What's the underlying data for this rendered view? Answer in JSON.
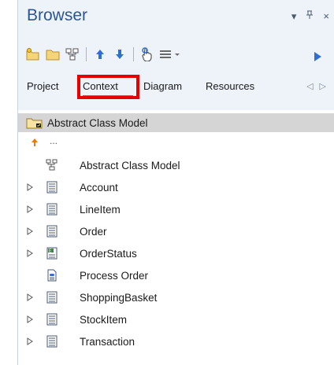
{
  "browser": {
    "title": "Browser",
    "controls": {
      "dropdown_glyph": "▾",
      "pin_glyph": "⊥",
      "close_glyph": "×"
    }
  },
  "toolbar": {
    "buttons": [
      {
        "icon": "new-package-icon"
      },
      {
        "icon": "folder-icon"
      },
      {
        "icon": "diagram-icon"
      },
      {
        "icon": "move-up-icon"
      },
      {
        "icon": "move-down-icon"
      },
      {
        "icon": "locate-icon"
      },
      {
        "icon": "menu-icon"
      },
      {
        "icon": "run-icon"
      }
    ]
  },
  "tabs": {
    "items": [
      "Project",
      "Context",
      "Diagram",
      "Resources"
    ],
    "active": "Context",
    "highlight_color": "#e60000",
    "nav_left": "◁",
    "nav_right": "▷"
  },
  "tree": {
    "root": {
      "label": "Abstract Class Model",
      "icon": "package-icon"
    },
    "up_label": "...",
    "items": [
      {
        "label": "Abstract Class Model",
        "icon": "diagram-icon",
        "expandable": false
      },
      {
        "label": "Account",
        "icon": "class-icon",
        "expandable": true
      },
      {
        "label": "LineItem",
        "icon": "class-icon",
        "expandable": true
      },
      {
        "label": "Order",
        "icon": "class-icon",
        "expandable": true
      },
      {
        "label": "OrderStatus",
        "icon": "enumeration-icon",
        "expandable": true
      },
      {
        "label": "Process Order",
        "icon": "activity-icon",
        "expandable": false
      },
      {
        "label": "ShoppingBasket",
        "icon": "class-icon",
        "expandable": true
      },
      {
        "label": "StockItem",
        "icon": "class-icon",
        "expandable": true
      },
      {
        "label": "Transaction",
        "icon": "class-icon",
        "expandable": true
      }
    ]
  },
  "colors": {
    "title": "#2b5593",
    "panel_bg": "#eef3fa",
    "root_row_bg": "#d5d5d5",
    "accent_blue": "#2f6fd0"
  }
}
